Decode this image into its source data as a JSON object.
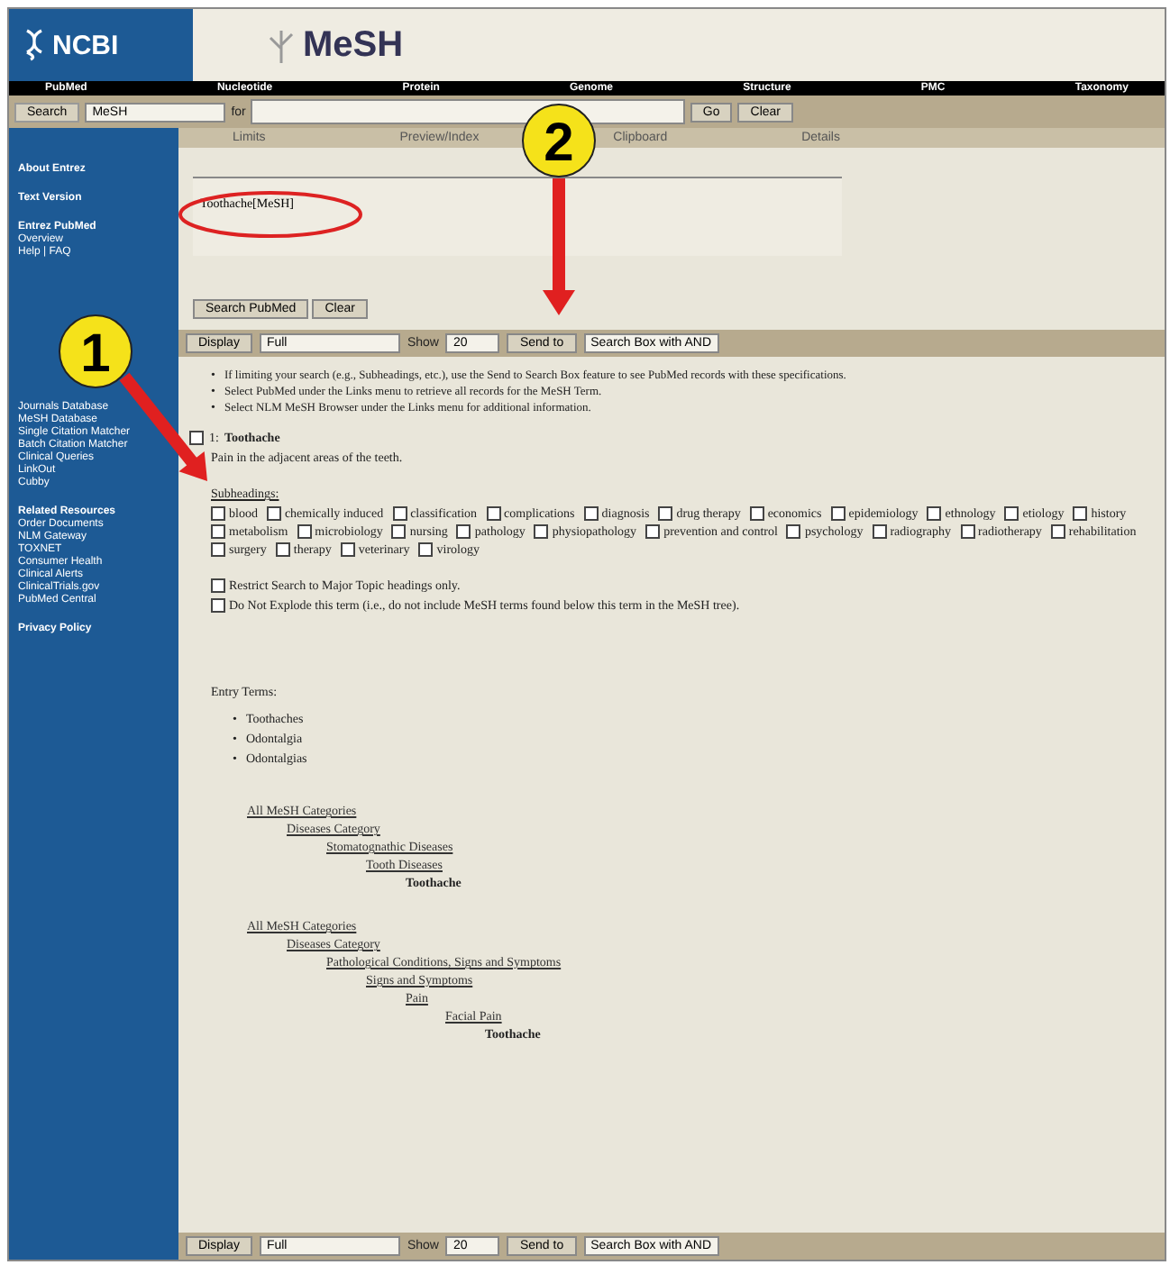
{
  "header": {
    "site_logo": "NCBI",
    "app_logo": "MeSH"
  },
  "nav": [
    "PubMed",
    "Nucleotide",
    "Protein",
    "Genome",
    "Structure",
    "PMC",
    "Taxonomy"
  ],
  "search": {
    "label": "Search",
    "database": "MeSH",
    "for_label": "for",
    "go": "Go",
    "clear": "Clear"
  },
  "tabs": [
    {
      "label": "Limits",
      "selected": false
    },
    {
      "label": "Preview/Index",
      "selected": false
    },
    {
      "label": "Clipboard",
      "selected": false
    },
    {
      "label": "Details",
      "selected": false
    }
  ],
  "query": {
    "value": "Toothache[MeSH]",
    "buttons": [
      "Search PubMed",
      "Clear"
    ]
  },
  "display_bars": [
    {
      "display": "Display",
      "format": "Full",
      "show": "Show",
      "count": "20",
      "send": "Send to",
      "target": "Search Box with AND"
    },
    {
      "display": "Display",
      "format": "Full",
      "show": "Show",
      "count": "20",
      "send": "Send to",
      "target": "Search Box with AND"
    }
  ],
  "sidebar": [
    {
      "heading": "About Entrez"
    },
    {
      "heading": "Text Version"
    },
    {
      "heading": "Entrez PubMed",
      "items": [
        "Overview",
        "Help | FAQ"
      ]
    },
    {
      "items": [
        "Journals Database",
        "MeSH Database",
        "Single Citation Matcher",
        "Batch Citation Matcher",
        "Clinical Queries",
        "LinkOut",
        "Cubby"
      ]
    },
    {
      "heading": "Related Resources",
      "items": [
        "Order Documents",
        "NLM Gateway",
        "TOXNET",
        "Consumer Health",
        "Clinical Alerts",
        "ClinicalTrials.gov",
        "PubMed Central"
      ]
    },
    {
      "heading": "Privacy Policy"
    }
  ],
  "tips": [
    {
      "bullet": "•",
      "text": "If limiting your search (e.g., Subheadings, etc.), use the Send to Search Box feature to see PubMed records with these specifications."
    },
    {
      "bullet": "•",
      "text": "Select PubMed under the Links menu to retrieve all records for the MeSH Term."
    },
    {
      "bullet": "•",
      "text": "Select NLM MeSH Browser under the Links menu for additional information."
    }
  ],
  "record": {
    "checked": false,
    "number": "1:",
    "title": "Toothache",
    "definition": "Pain in the adjacent areas of the teeth."
  },
  "subheadings": {
    "label": "Subheadings:",
    "items": [
      {
        "label": "blood",
        "checked": false
      },
      {
        "label": "chemically induced",
        "checked": false
      },
      {
        "label": "classification",
        "checked": false
      },
      {
        "label": "complications",
        "checked": false
      },
      {
        "label": "diagnosis",
        "checked": false
      },
      {
        "label": "drug therapy",
        "checked": false
      },
      {
        "label": "economics",
        "checked": false
      },
      {
        "label": "epidemiology",
        "checked": false
      },
      {
        "label": "ethnology",
        "checked": false
      },
      {
        "label": "etiology",
        "checked": false
      },
      {
        "label": "history",
        "checked": false
      },
      {
        "label": "metabolism",
        "checked": false
      },
      {
        "label": "microbiology",
        "checked": false
      },
      {
        "label": "nursing",
        "checked": false
      },
      {
        "label": "pathology",
        "checked": false
      },
      {
        "label": "physiopathology",
        "checked": false
      },
      {
        "label": "prevention and control",
        "checked": false
      },
      {
        "label": "psychology",
        "checked": false
      },
      {
        "label": "radiography",
        "checked": false
      },
      {
        "label": "radiotherapy",
        "checked": false
      },
      {
        "label": "rehabilitation",
        "checked": false
      },
      {
        "label": "surgery",
        "checked": false
      },
      {
        "label": "therapy",
        "checked": false
      },
      {
        "label": "veterinary",
        "checked": false
      },
      {
        "label": "virology",
        "checked": false
      }
    ]
  },
  "options": [
    {
      "label": "Restrict Search to Major Topic headings only.",
      "checked": false
    },
    {
      "label": "Do Not Explode this term (i.e., do not include MeSH terms found below this term in the MeSH tree).",
      "checked": false
    }
  ],
  "entry_terms": {
    "label": "Entry Terms:",
    "items": [
      {
        "bullet": "•",
        "text": "Toothaches"
      },
      {
        "bullet": "•",
        "text": "Odontalgia"
      },
      {
        "bullet": "•",
        "text": "Odontalgias"
      }
    ]
  },
  "trees": [
    {
      "label": "All MeSH Categories",
      "children": [
        {
          "label": "Diseases Category",
          "children": [
            {
              "label": "Stomatognathic Diseases",
              "children": [
                {
                  "label": "Tooth Diseases",
                  "children": [
                    {
                      "label": "Toothache"
                    }
                  ]
                }
              ]
            }
          ]
        }
      ]
    },
    {
      "label": "All MeSH Categories",
      "children": [
        {
          "label": "Diseases Category",
          "children": [
            {
              "label": "Pathological Conditions, Signs and Symptoms",
              "children": [
                {
                  "label": "Signs and Symptoms",
                  "children": [
                    {
                      "label": "Pain",
                      "children": [
                        {
                          "label": "Facial Pain",
                          "children": [
                            {
                              "label": "Toothache"
                            }
                          ]
                        }
                      ]
                    }
                  ]
                }
              ]
            }
          ]
        }
      ]
    }
  ],
  "annotations": [
    "1",
    "2"
  ]
}
